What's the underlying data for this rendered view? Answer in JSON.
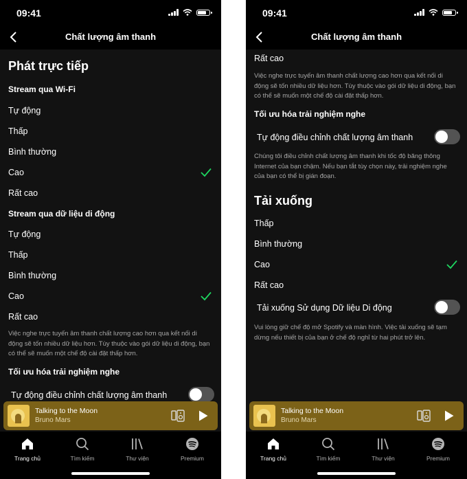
{
  "status": {
    "time": "09:41"
  },
  "header": {
    "title": "Chất lượng âm thanh"
  },
  "left": {
    "section_title": "Phát trực tiếp",
    "wifi_title": "Stream qua Wi-Fi",
    "wifi_options": [
      "Tự động",
      "Thấp",
      "Bình thường",
      "Cao",
      "Rất cao"
    ],
    "cellular_title": "Stream qua dữ liệu di động",
    "cellular_options": [
      "Tự động",
      "Thấp",
      "Bình thường",
      "Cao",
      "Rất cao"
    ],
    "cellular_desc": "Việc nghe trực tuyến âm thanh chất lượng cao hơn qua kết nối di động sẽ tốn nhiều dữ liệu hơn. Tùy thuộc vào gói dữ liệu di động, bạn có thể sẽ muốn một chế độ cài đặt thấp hơn.",
    "optimize_title": "Tối ưu hóa trải nghiệm nghe",
    "auto_adjust_label": "Tự động điều chỉnh chất lượng âm thanh"
  },
  "right": {
    "very_high": "Rất cao",
    "cellular_desc": "Việc nghe trực tuyến âm thanh chất lượng cao hơn qua kết nối di động sẽ tốn nhiều dữ liệu hơn. Tùy thuộc vào gói dữ liệu di động, bạn có thể sẽ muốn một chế độ cài đặt thấp hơn.",
    "optimize_title": "Tối ưu hóa trải nghiệm nghe",
    "auto_adjust_label": "Tự động điều chỉnh chất lượng âm thanh",
    "auto_adjust_desc": "Chúng tôi điều chỉnh chất lượng âm thanh khi tốc độ băng thông Internet của bạn chậm. Nếu bạn tắt tùy chọn này, trải nghiệm nghe của bạn có thể bị gián đoạn.",
    "download_title": "Tải xuống",
    "download_options": [
      "Thấp",
      "Bình thường",
      "Cao",
      "Rất cao"
    ],
    "download_cellular_label": "Tải xuống Sử dụng Dữ liệu Di động",
    "download_desc": "Vui lòng giữ chế độ mở Spotify và màn hình. Việc tải xuống sẽ tạm dừng nếu thiết bị của bạn ở chế độ nghỉ từ hai phút trở lên."
  },
  "player": {
    "song": "Talking to the Moon",
    "artist": "Bruno Mars"
  },
  "nav": {
    "items": [
      "Trang chủ",
      "Tìm kiếm",
      "Thư viện",
      "Premium"
    ]
  },
  "selection": {
    "wifi_selected": "Cao",
    "cellular_selected": "Cao",
    "download_selected": "Cao"
  },
  "toggles": {
    "auto_adjust_on": false,
    "download_cellular_on": false
  },
  "colors": {
    "accent": "#1ed760",
    "player_bg": "#7c6218",
    "background": "#121212"
  },
  "icons": [
    "back-chevron-icon",
    "checkmark-icon",
    "connect-device-icon",
    "play-icon",
    "home-icon",
    "search-icon",
    "library-icon",
    "spotify-logo-icon"
  ]
}
